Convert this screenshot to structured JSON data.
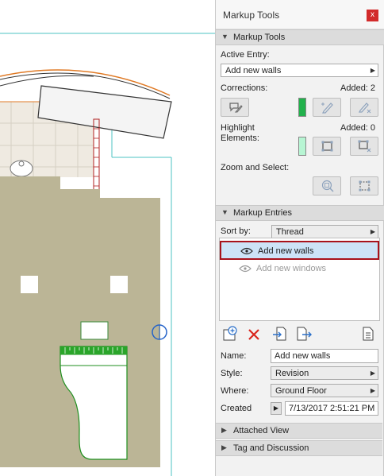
{
  "window": {
    "title": "Markup Tools",
    "close_glyph": "x"
  },
  "sections": {
    "markup_tools": "Markup Tools",
    "markup_entries": "Markup Entries",
    "attached_view": "Attached View",
    "tag_discussion": "Tag and Discussion"
  },
  "active_entry": {
    "label": "Active Entry:",
    "value": "Add new walls"
  },
  "corrections": {
    "label": "Corrections:",
    "added": "Added: 2",
    "swatch_color": "#22b14c"
  },
  "highlight": {
    "label_line1": "Highlight",
    "label_line2": "Elements:",
    "added": "Added: 0",
    "swatch_color": "#b7f5d3"
  },
  "zoom_select": {
    "label": "Zoom and Select:"
  },
  "sort": {
    "label": "Sort by:",
    "value": "Thread"
  },
  "entries": [
    {
      "label": "Add new walls",
      "selected": true,
      "icon": "eye-icon"
    },
    {
      "label": "Add new windows",
      "selected": false,
      "icon": "eye-icon"
    }
  ],
  "entry_toolbar": {
    "icons": [
      "new-entry-icon",
      "delete-icon",
      "import-icon",
      "export-icon",
      "report-icon"
    ]
  },
  "properties": {
    "name_label": "Name:",
    "name_value": "Add new walls",
    "style_label": "Style:",
    "style_value": "Revision",
    "where_label": "Where:",
    "where_value": "Ground Floor",
    "created_label": "Created",
    "created_value": "7/13/2017 2:51:21 PM"
  },
  "colors": {
    "highlight_border": "#a8121b",
    "selection_fill": "#cde3f7",
    "delete_red": "#d9251c"
  }
}
